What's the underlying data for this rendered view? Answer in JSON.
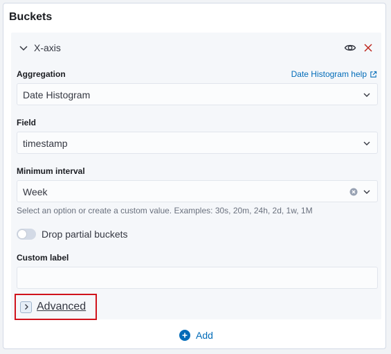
{
  "panel": {
    "title": "Buckets"
  },
  "bucket": {
    "title": "X-axis",
    "aggregation": {
      "label": "Aggregation",
      "help_link": "Date Histogram help",
      "value": "Date Histogram"
    },
    "field": {
      "label": "Field",
      "value": "timestamp"
    },
    "interval": {
      "label": "Minimum interval",
      "value": "Week",
      "hint": "Select an option or create a custom value. Examples: 30s, 20m, 24h, 2d, 1w, 1M"
    },
    "drop_partial": {
      "label": "Drop partial buckets",
      "checked": false
    },
    "custom_label": {
      "label": "Custom label",
      "value": ""
    },
    "advanced_label": "Advanced"
  },
  "add_label": "Add",
  "colors": {
    "link": "#006bb8",
    "highlight": "#d0121b",
    "close": "#bd271e"
  },
  "icons": [
    "chevron-down-icon",
    "eye-icon",
    "close-icon",
    "external-link-icon",
    "clear-icon",
    "chevron-right-icon",
    "plus-circle-icon"
  ]
}
